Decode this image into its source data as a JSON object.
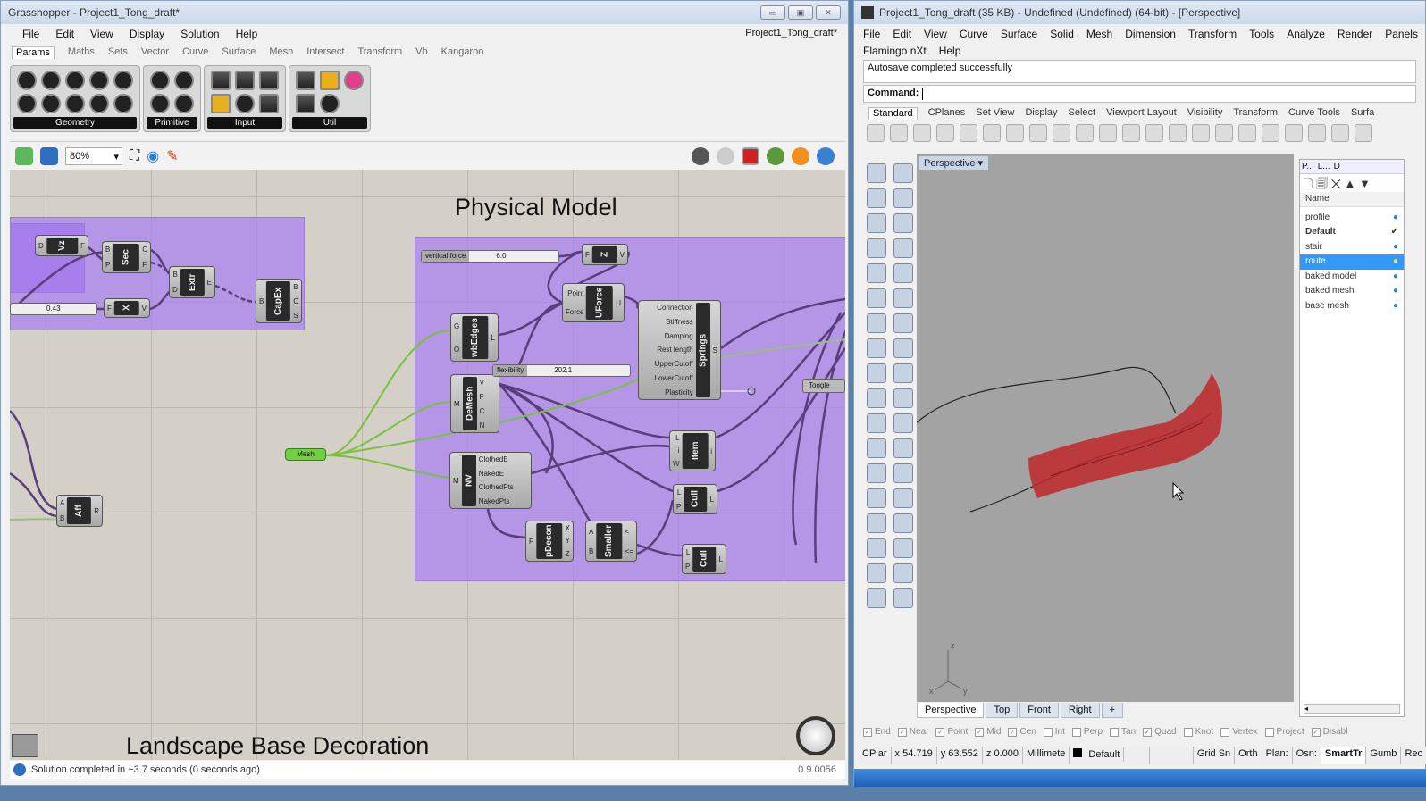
{
  "grasshopper": {
    "title": "Grasshopper - Project1_Tong_draft*",
    "doc_name": "Project1_Tong_draft*",
    "menu": [
      "File",
      "Edit",
      "View",
      "Display",
      "Solution",
      "Help"
    ],
    "tabs": [
      "Params",
      "Maths",
      "Sets",
      "Vector",
      "Curve",
      "Surface",
      "Mesh",
      "Intersect",
      "Transform",
      "Vb",
      "Kangaroo"
    ],
    "ribbon_groups": [
      "Geometry",
      "Primitive",
      "Input",
      "Util"
    ],
    "zoom": "80%",
    "canvas": {
      "group_titles": [
        "Physical Model",
        "Landscape Base Decoration"
      ],
      "components": [
        {
          "name": "Vz",
          "in": [
            "D"
          ],
          "out": [
            "F"
          ]
        },
        {
          "name": "Sec",
          "in": [
            "B",
            "P"
          ],
          "out": [
            "C",
            "F"
          ]
        },
        {
          "name": "Extr",
          "in": [
            "B",
            "D"
          ],
          "out": [
            "E"
          ]
        },
        {
          "name": "CapEx",
          "in": [
            "B"
          ],
          "out": [
            "B",
            "C",
            "S"
          ]
        },
        {
          "name": "X",
          "in": [
            "F"
          ],
          "out": [
            "V"
          ]
        },
        {
          "name": "Z",
          "in": [
            "F"
          ],
          "out": [
            "V"
          ]
        },
        {
          "name": "UForce",
          "in": [
            "Point",
            "Force"
          ],
          "out": [
            "U"
          ]
        },
        {
          "name": "wbEdges",
          "in": [
            "G",
            "O"
          ],
          "out": [
            "L"
          ]
        },
        {
          "name": "Springs",
          "in": [
            "Connection",
            "Stiffness",
            "Damping",
            "Rest length",
            "UpperCutoff",
            "LowerCutoff",
            "Plasticity"
          ],
          "out": [
            "S"
          ]
        },
        {
          "name": "DeMesh",
          "in": [
            "M"
          ],
          "out": [
            "V",
            "F",
            "C",
            "N"
          ]
        },
        {
          "name": "NV",
          "in": [
            "M"
          ],
          "out": [
            "ClothedE",
            "NakedE",
            "ClothedPts",
            "NakedPts"
          ]
        },
        {
          "name": "Item",
          "in": [
            "L",
            "i",
            "W"
          ],
          "out": [
            "i"
          ]
        },
        {
          "name": "Cull",
          "in": [
            "L",
            "P"
          ],
          "out": [
            "L"
          ]
        },
        {
          "name": "pDecon",
          "in": [
            "P"
          ],
          "out": [
            "X",
            "Y",
            "Z"
          ]
        },
        {
          "name": "Smaller",
          "in": [
            "A",
            "B"
          ],
          "out": [
            "<",
            "<="
          ]
        },
        {
          "name": "Cull",
          "in": [
            "L",
            "P"
          ],
          "out": [
            "L"
          ]
        },
        {
          "name": "Aff",
          "in": [
            "A",
            "B"
          ],
          "out": [
            "R"
          ]
        }
      ],
      "sliders": [
        {
          "label": "",
          "value": "0.43"
        },
        {
          "label": "vertical force",
          "value": "6.0"
        },
        {
          "label": "flexibility",
          "value": "202.1"
        }
      ],
      "mesh_param": "Mesh",
      "toggle": "Toggle"
    },
    "status": "Solution completed in ~3.7 seconds (0 seconds ago)",
    "version": "0.9.0056"
  },
  "rhino": {
    "title": "Project1_Tong_draft (35 KB) - Undefined (Undefined) (64-bit) - [Perspective]",
    "menu": [
      "File",
      "Edit",
      "View",
      "Curve",
      "Surface",
      "Solid",
      "Mesh",
      "Dimension",
      "Transform",
      "Tools",
      "Analyze",
      "Render",
      "Panels"
    ],
    "menu2": [
      "Flamingo nXt",
      "Help"
    ],
    "history": "Autosave completed successfully",
    "command_label": "Command:",
    "toolbar_tabs": [
      "Standard",
      "CPlanes",
      "Set View",
      "Display",
      "Select",
      "Viewport Layout",
      "Visibility",
      "Transform",
      "Curve Tools",
      "Surfa"
    ],
    "viewport_label": "Perspective",
    "viewport_tabs": [
      "Perspective",
      "Top",
      "Front",
      "Right"
    ],
    "panel_tabs": [
      "P...",
      "L...",
      "D"
    ],
    "layers_header": "Name",
    "layers": [
      {
        "name": "profile",
        "state": "bulb"
      },
      {
        "name": "Default",
        "state": "✔"
      },
      {
        "name": "stair",
        "state": "bulb"
      },
      {
        "name": "route",
        "state": "bulb",
        "selected": true
      },
      {
        "name": "baked model",
        "state": "bulb"
      },
      {
        "name": "baked mesh",
        "state": "bulb"
      },
      {
        "name": "base mesh",
        "state": "bulb"
      }
    ],
    "osnaps": [
      {
        "name": "End",
        "on": true
      },
      {
        "name": "Near",
        "on": true
      },
      {
        "name": "Point",
        "on": true
      },
      {
        "name": "Mid",
        "on": true
      },
      {
        "name": "Cen",
        "on": true
      },
      {
        "name": "Int",
        "on": false
      },
      {
        "name": "Perp",
        "on": false
      },
      {
        "name": "Tan",
        "on": false
      },
      {
        "name": "Quad",
        "on": true
      },
      {
        "name": "Knot",
        "on": false
      },
      {
        "name": "Vertex",
        "on": false
      },
      {
        "name": "Project",
        "on": false
      },
      {
        "name": "Disabl",
        "on": true
      }
    ],
    "status": {
      "cplane": "CPlar",
      "x": "x 54.719",
      "y": "y 63.552",
      "z": "z 0.000",
      "units": "Millimete",
      "layer": "Default",
      "toggles": [
        "Grid Sn",
        "Orth",
        "Plan:",
        "Osn:",
        "SmartTr",
        "Gumb",
        "Rec"
      ]
    },
    "surface_color": "#c0282a"
  }
}
